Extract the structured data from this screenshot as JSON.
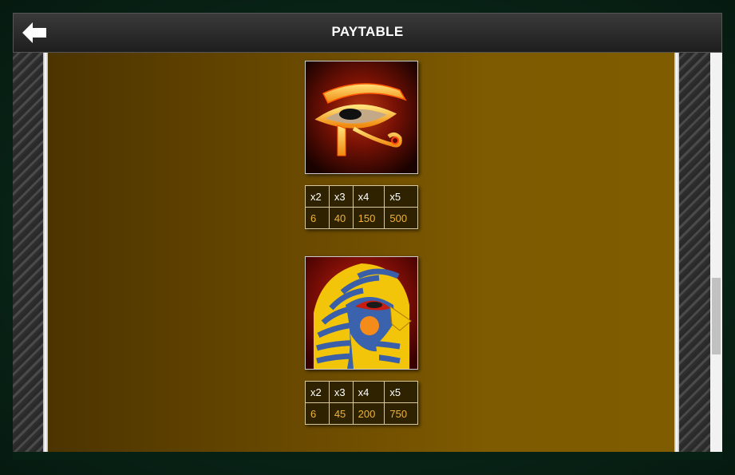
{
  "header": {
    "title": "PAYTABLE",
    "back_icon": "left-arrow-icon"
  },
  "symbols": [
    {
      "name": "Eye of Horus",
      "icon": "eye-of-horus-icon",
      "columns": [
        "x2",
        "x3",
        "x4",
        "x5"
      ],
      "payouts": [
        "6",
        "40",
        "150",
        "500"
      ]
    },
    {
      "name": "Pharaoh falcon",
      "icon": "pharaoh-falcon-icon",
      "columns": [
        "x2",
        "x3",
        "x4",
        "x5"
      ],
      "payouts": [
        "6",
        "45",
        "200",
        "750"
      ]
    }
  ],
  "colors": {
    "header_text": "#ffffff",
    "payout_text": "#f0b43a",
    "content_bg": "#7e5a00"
  }
}
